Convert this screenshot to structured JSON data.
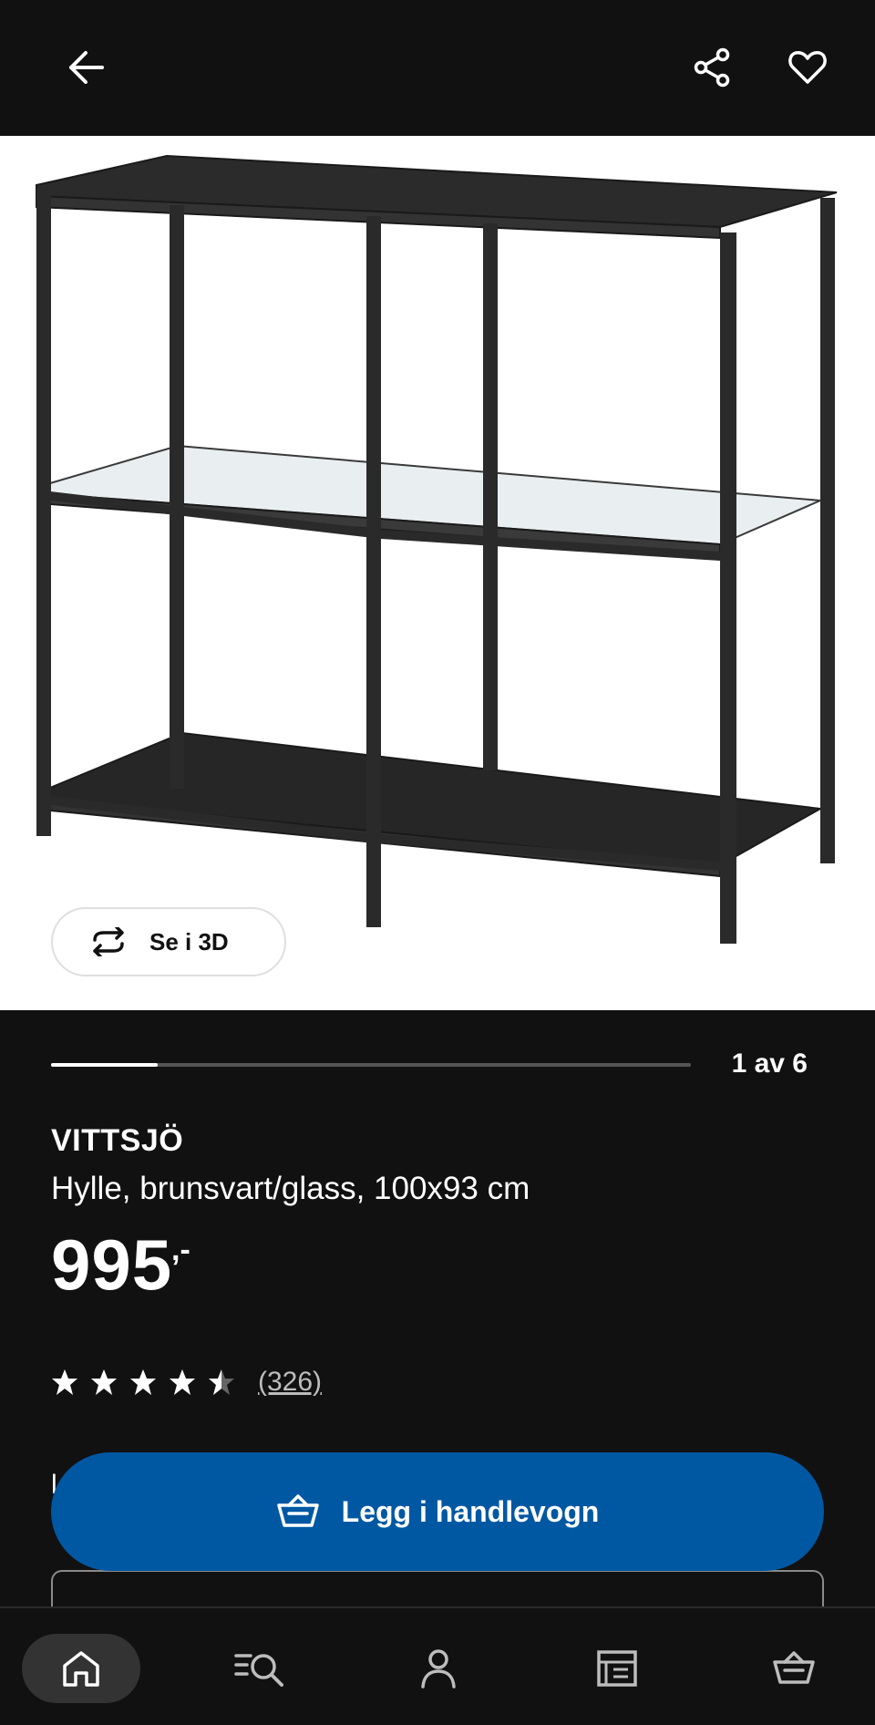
{
  "header": {
    "back_icon": "arrow-left-icon",
    "share_icon": "share-icon",
    "favorite_icon": "heart-icon"
  },
  "hero": {
    "view_3d_label": "Se i 3D",
    "view_3d_icon": "rotate-3d-icon"
  },
  "gallery": {
    "counter": "1 av 6",
    "current": 1,
    "total": 6
  },
  "product": {
    "name": "VITTSJÖ",
    "description": "Hylle, brunsvart/glass, 100x93 cm",
    "price": "995",
    "price_suffix": ",-",
    "rating": 4.5,
    "rating_max": 5,
    "review_count": "(326)"
  },
  "actions": {
    "add_to_cart_label": "Legg i handlevogn",
    "add_to_cart_icon": "basket-icon",
    "partially_hidden_text": "l"
  },
  "bottom_nav": {
    "items": [
      {
        "icon": "home-icon",
        "active": true
      },
      {
        "icon": "search-browse-icon",
        "active": false
      },
      {
        "icon": "profile-icon",
        "active": false
      },
      {
        "icon": "store-icon",
        "active": false
      },
      {
        "icon": "basket-icon",
        "active": false
      }
    ]
  },
  "colors": {
    "background": "#111111",
    "accent_blue": "#0058a3",
    "text": "#ffffff",
    "muted_text": "#bdbdbd"
  }
}
